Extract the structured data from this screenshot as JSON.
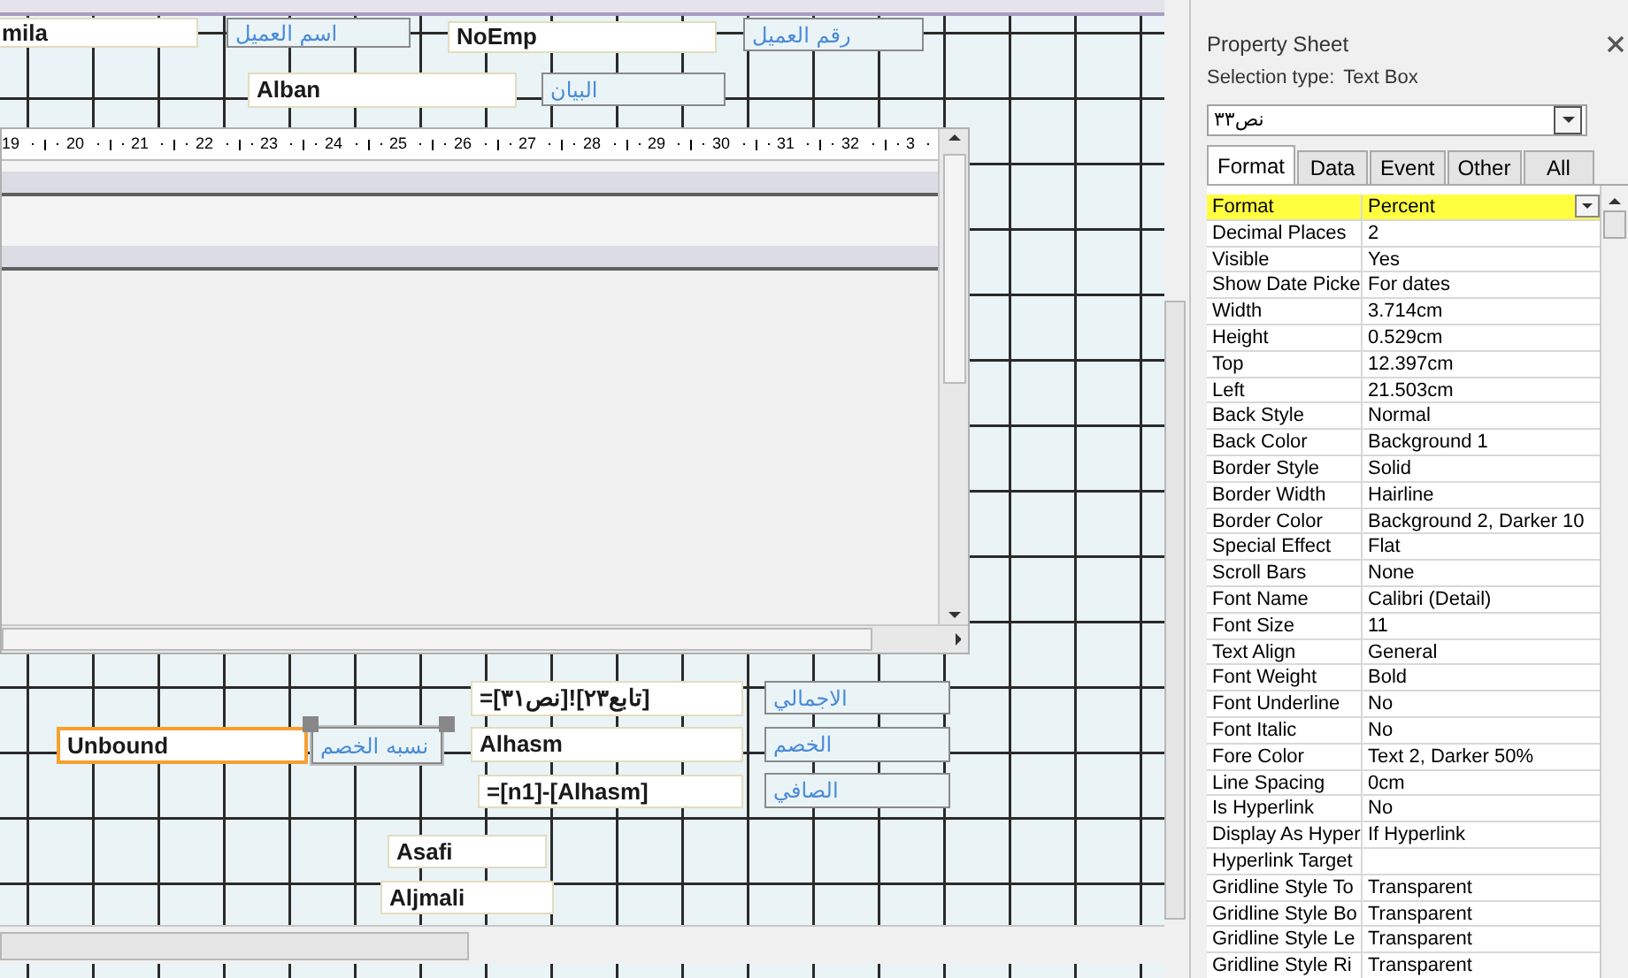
{
  "design_canvas": {
    "controls": [
      {
        "kind": "textbox",
        "text": "mila",
        "selected": false
      },
      {
        "kind": "label",
        "text": "اسم العميل",
        "selected": false
      },
      {
        "kind": "textbox",
        "text": "NoEmp",
        "selected": false
      },
      {
        "kind": "label",
        "text": "رقم العميل",
        "selected": false
      },
      {
        "kind": "textbox",
        "text": "Alban",
        "selected": false
      },
      {
        "kind": "label",
        "text": "البيان",
        "selected": false
      },
      {
        "kind": "textbox",
        "text": "=[نص٣١]![تابع٢٣]",
        "selected": false
      },
      {
        "kind": "label",
        "text": "الاجمالي",
        "selected": false
      },
      {
        "kind": "textbox",
        "text": "Unbound",
        "selected": true
      },
      {
        "kind": "label",
        "text": "نسبه الخصم",
        "selected": true
      },
      {
        "kind": "textbox",
        "text": "Alhasm",
        "selected": false
      },
      {
        "kind": "label",
        "text": "الخصم",
        "selected": false
      },
      {
        "kind": "textbox",
        "text": "=[n1]-[Alhasm]",
        "selected": false
      },
      {
        "kind": "label",
        "text": "الصافي",
        "selected": false
      },
      {
        "kind": "textbox",
        "text": "Asafi",
        "selected": false
      },
      {
        "kind": "textbox",
        "text": "Aljmali",
        "selected": false
      }
    ],
    "subform": {
      "ruler": [
        "19",
        "20",
        "21",
        "22",
        "23",
        "24",
        "25",
        "26",
        "27",
        "28",
        "29",
        "30",
        "31",
        "32",
        "3"
      ]
    }
  },
  "property_sheet": {
    "title": "Property Sheet",
    "selection_type_label": "Selection type:",
    "selection_type": "Text Box",
    "object_name": "نص٣٣",
    "tabs": [
      {
        "label": "Format",
        "selected": true
      },
      {
        "label": "Data",
        "selected": false
      },
      {
        "label": "Event",
        "selected": false
      },
      {
        "label": "Other",
        "selected": false
      },
      {
        "label": "All",
        "selected": false
      }
    ],
    "rows": [
      {
        "name": "Format",
        "value": "Percent",
        "highlighted": true
      },
      {
        "name": "Decimal Places",
        "value": "2",
        "highlighted": false
      },
      {
        "name": "Visible",
        "value": "Yes",
        "highlighted": false
      },
      {
        "name": "Show Date Picke",
        "value": "For dates",
        "highlighted": false
      },
      {
        "name": "Width",
        "value": "3.714cm",
        "highlighted": false
      },
      {
        "name": "Height",
        "value": "0.529cm",
        "highlighted": false
      },
      {
        "name": "Top",
        "value": "12.397cm",
        "highlighted": false
      },
      {
        "name": "Left",
        "value": "21.503cm",
        "highlighted": false
      },
      {
        "name": "Back Style",
        "value": "Normal",
        "highlighted": false
      },
      {
        "name": "Back Color",
        "value": "Background 1",
        "highlighted": false
      },
      {
        "name": "Border Style",
        "value": "Solid",
        "highlighted": false
      },
      {
        "name": "Border Width",
        "value": "Hairline",
        "highlighted": false
      },
      {
        "name": "Border Color",
        "value": "Background 2, Darker 10",
        "highlighted": false
      },
      {
        "name": "Special Effect",
        "value": "Flat",
        "highlighted": false
      },
      {
        "name": "Scroll Bars",
        "value": "None",
        "highlighted": false
      },
      {
        "name": "Font Name",
        "value": "Calibri (Detail)",
        "highlighted": false
      },
      {
        "name": "Font Size",
        "value": "11",
        "highlighted": false
      },
      {
        "name": "Text Align",
        "value": "General",
        "highlighted": false
      },
      {
        "name": "Font Weight",
        "value": "Bold",
        "highlighted": false
      },
      {
        "name": "Font Underline",
        "value": "No",
        "highlighted": false
      },
      {
        "name": "Font Italic",
        "value": "No",
        "highlighted": false
      },
      {
        "name": "Fore Color",
        "value": "Text 2, Darker 50%",
        "highlighted": false
      },
      {
        "name": "Line Spacing",
        "value": "0cm",
        "highlighted": false
      },
      {
        "name": "Is Hyperlink",
        "value": "No",
        "highlighted": false
      },
      {
        "name": "Display As Hyper",
        "value": "If Hyperlink",
        "highlighted": false
      },
      {
        "name": "Hyperlink Target",
        "value": "",
        "highlighted": false
      },
      {
        "name": "Gridline Style To",
        "value": "Transparent",
        "highlighted": false
      },
      {
        "name": "Gridline Style Bo",
        "value": "Transparent",
        "highlighted": false
      },
      {
        "name": "Gridline Style Le",
        "value": "Transparent",
        "highlighted": false
      },
      {
        "name": "Gridline Style Ri",
        "value": "Transparent",
        "highlighted": false
      }
    ]
  }
}
